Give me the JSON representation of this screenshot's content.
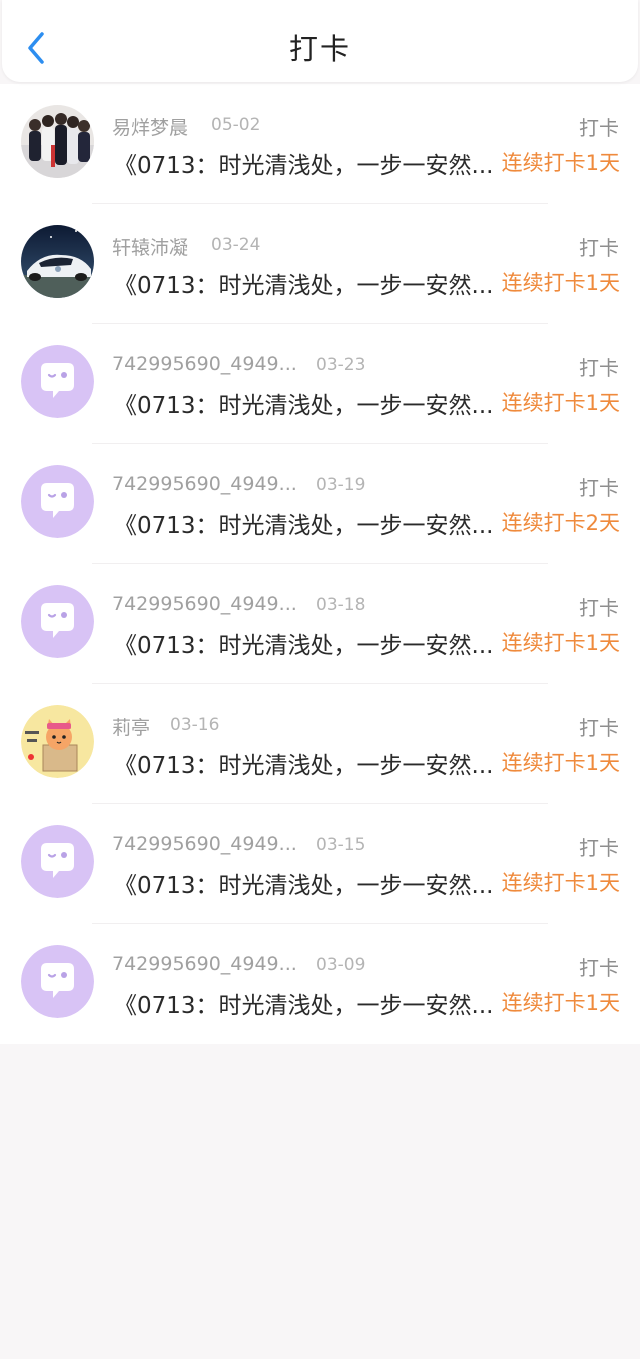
{
  "header": {
    "title": "打卡",
    "back_icon": "chevron-left-icon",
    "accent": "#2d8ef0"
  },
  "colors": {
    "streak": "#ef8a3c",
    "default_avatar_bg": "#d8c3f5"
  },
  "items": [
    {
      "avatar": "group-photo",
      "name": "易烊梦晨",
      "date": "05-02",
      "tag": "打卡",
      "content": "《0713：时光清浅处，一步一安然...",
      "streak": "连续打卡1天"
    },
    {
      "avatar": "car-photo",
      "name": "轩辕沛凝",
      "date": "03-24",
      "tag": "打卡",
      "content": "《0713：时光清浅处，一步一安然...",
      "streak": "连续打卡1天"
    },
    {
      "avatar": "default-chat-avatar",
      "name": "742995690_4949...",
      "date": "03-23",
      "tag": "打卡",
      "content": "《0713：时光清浅处，一步一安然...",
      "streak": "连续打卡1天"
    },
    {
      "avatar": "default-chat-avatar",
      "name": "742995690_4949...",
      "date": "03-19",
      "tag": "打卡",
      "content": "《0713：时光清浅处，一步一安然...",
      "streak": "连续打卡2天"
    },
    {
      "avatar": "default-chat-avatar",
      "name": "742995690_4949...",
      "date": "03-18",
      "tag": "打卡",
      "content": "《0713：时光清浅处，一步一安然...",
      "streak": "连续打卡1天"
    },
    {
      "avatar": "cat-sticker",
      "name": "莉亭",
      "date": "03-16",
      "tag": "打卡",
      "content": "《0713：时光清浅处，一步一安然...",
      "streak": "连续打卡1天"
    },
    {
      "avatar": "default-chat-avatar",
      "name": "742995690_4949...",
      "date": "03-15",
      "tag": "打卡",
      "content": "《0713：时光清浅处，一步一安然...",
      "streak": "连续打卡1天"
    },
    {
      "avatar": "default-chat-avatar",
      "name": "742995690_4949...",
      "date": "03-09",
      "tag": "打卡",
      "content": "《0713：时光清浅处，一步一安然...",
      "streak": "连续打卡1天"
    }
  ]
}
